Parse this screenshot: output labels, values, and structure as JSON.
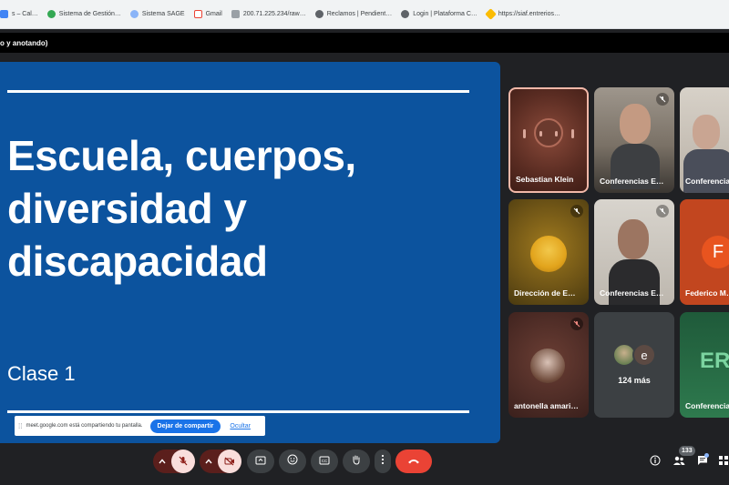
{
  "bookmarks": [
    {
      "label": "s – Cal…",
      "color": "#4285f4"
    },
    {
      "label": "Sistema de Gestión…",
      "color": "#34a853"
    },
    {
      "label": "Sistema SAGE",
      "color": "#8ab4f8"
    },
    {
      "label": "Gmail",
      "color": "#ea4335"
    },
    {
      "label": "200.71.225.234/raw…",
      "color": "#9aa0a6"
    },
    {
      "label": "Reclamos | Pendient…",
      "color": "#5f6368"
    },
    {
      "label": "Login | Plataforma C…",
      "color": "#5f6368"
    },
    {
      "label": "https://siaf.entrerios…",
      "color": "#fbbc04"
    }
  ],
  "window_title": "o y anotando)",
  "slide": {
    "title": "Escuela, cuerpos, diversidad y discapacidad",
    "subtitle": "Clase 1"
  },
  "share_bar": {
    "message": "meet.google.com está compartiendo tu pantalla.",
    "stop_label": "Dejar de compartir",
    "hide_label": "Ocultar"
  },
  "participants": {
    "t1": "Sebastian Klein",
    "t2": "Conferencias E…",
    "t3": "Conferencia…",
    "t4": "Dirección de E…",
    "t5": "Conferencias E…",
    "t6": "Federico M…",
    "t6_initial": "F",
    "t7": "antonella amari…",
    "more_label": "124 más",
    "more_initial": "e",
    "t9": "Conferencia…",
    "t9_logo": "ER"
  },
  "people_count": "133",
  "icons": {
    "controls": [
      "chevron-up-icon",
      "mic-off-icon",
      "chevron-up-icon",
      "camera-off-icon",
      "present-icon",
      "emoji-icon",
      "captions-icon",
      "hand-icon",
      "more-icon",
      "end-call-icon"
    ],
    "right": [
      "info-icon",
      "people-icon",
      "chat-icon",
      "activities-icon"
    ]
  },
  "colors": {
    "slide_bg": "#0c539e",
    "end_call": "#ea4335",
    "mic_off_bg": "#f9dedc",
    "share_button": "#1a73e8"
  }
}
